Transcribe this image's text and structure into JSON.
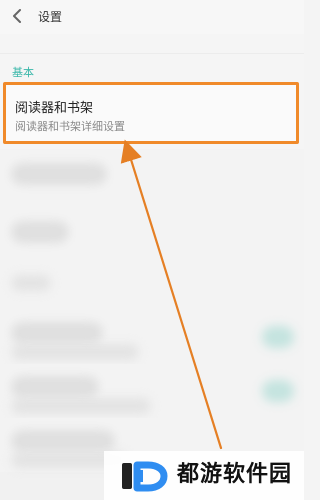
{
  "header": {
    "title": "设置"
  },
  "section": {
    "title": "基本"
  },
  "settings_item": {
    "title": "阅读器和书架",
    "subtitle": "阅读器和书架详细设置"
  },
  "watermark": {
    "text": "都游软件园"
  },
  "colors": {
    "accent": "#39b7a9",
    "highlight": "#f08a2a",
    "background": "#f5f5f5"
  },
  "icons": {
    "back": "chevron-left-icon",
    "logo": "d-logo-icon",
    "arrow": "arrow-annotation-icon"
  }
}
